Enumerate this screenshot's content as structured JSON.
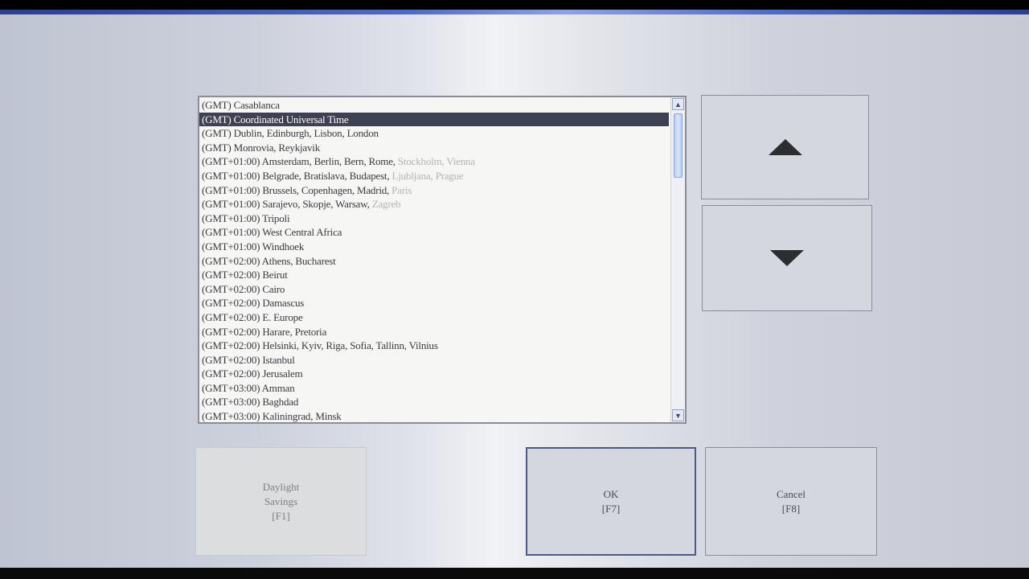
{
  "timezone_list": {
    "items": [
      {
        "label": "(GMT) Casablanca",
        "faint": ""
      },
      {
        "label": "(GMT) Coordinated Universal Time",
        "faint": "",
        "selected": true
      },
      {
        "label": "(GMT) Dublin, Edinburgh, Lisbon, London",
        "faint": ""
      },
      {
        "label": "(GMT) Monrovia, Reykjavik",
        "faint": ""
      },
      {
        "label": "(GMT+01:00) Amsterdam, Berlin, Bern, Rome, ",
        "faint": "Stockholm, Vienna"
      },
      {
        "label": "(GMT+01:00) Belgrade, Bratislava, Budapest, ",
        "faint": "Ljubljana, Prague"
      },
      {
        "label": "(GMT+01:00) Brussels, Copenhagen, Madrid, ",
        "faint": "Paris"
      },
      {
        "label": "(GMT+01:00) Sarajevo, Skopje, Warsaw, ",
        "faint": "Zagreb"
      },
      {
        "label": "(GMT+01:00) Tripoli",
        "faint": ""
      },
      {
        "label": "(GMT+01:00) West Central Africa",
        "faint": ""
      },
      {
        "label": "(GMT+01:00) Windhoek",
        "faint": ""
      },
      {
        "label": "(GMT+02:00) Athens, Bucharest",
        "faint": ""
      },
      {
        "label": "(GMT+02:00) Beirut",
        "faint": ""
      },
      {
        "label": "(GMT+02:00) Cairo",
        "faint": ""
      },
      {
        "label": "(GMT+02:00) Damascus",
        "faint": ""
      },
      {
        "label": "(GMT+02:00) E. Europe",
        "faint": ""
      },
      {
        "label": "(GMT+02:00) Harare, Pretoria",
        "faint": ""
      },
      {
        "label": "(GMT+02:00) Helsinki, Kyiv, Riga, Sofia, Tallinn, Vilnius",
        "faint": ""
      },
      {
        "label": "(GMT+02:00) Istanbul",
        "faint": ""
      },
      {
        "label": "(GMT+02:00) Jerusalem",
        "faint": ""
      },
      {
        "label": "(GMT+03:00) Amman",
        "faint": ""
      },
      {
        "label": "(GMT+03:00) Baghdad",
        "faint": ""
      },
      {
        "label": "(GMT+03:00) Kaliningrad, Minsk",
        "faint": ""
      }
    ]
  },
  "scroll_icons": {
    "up": "▲",
    "down": "▼"
  },
  "buttons": {
    "daylight": {
      "line1": "Daylight",
      "line2": "Savings",
      "line3": "[F1]"
    },
    "ok": {
      "line1": "OK",
      "line2": "[F7]"
    },
    "cancel": {
      "line1": "Cancel",
      "line2": "[F8]"
    }
  },
  "colors": {
    "selection": "#3d4152",
    "accent": "#4d5a86"
  }
}
